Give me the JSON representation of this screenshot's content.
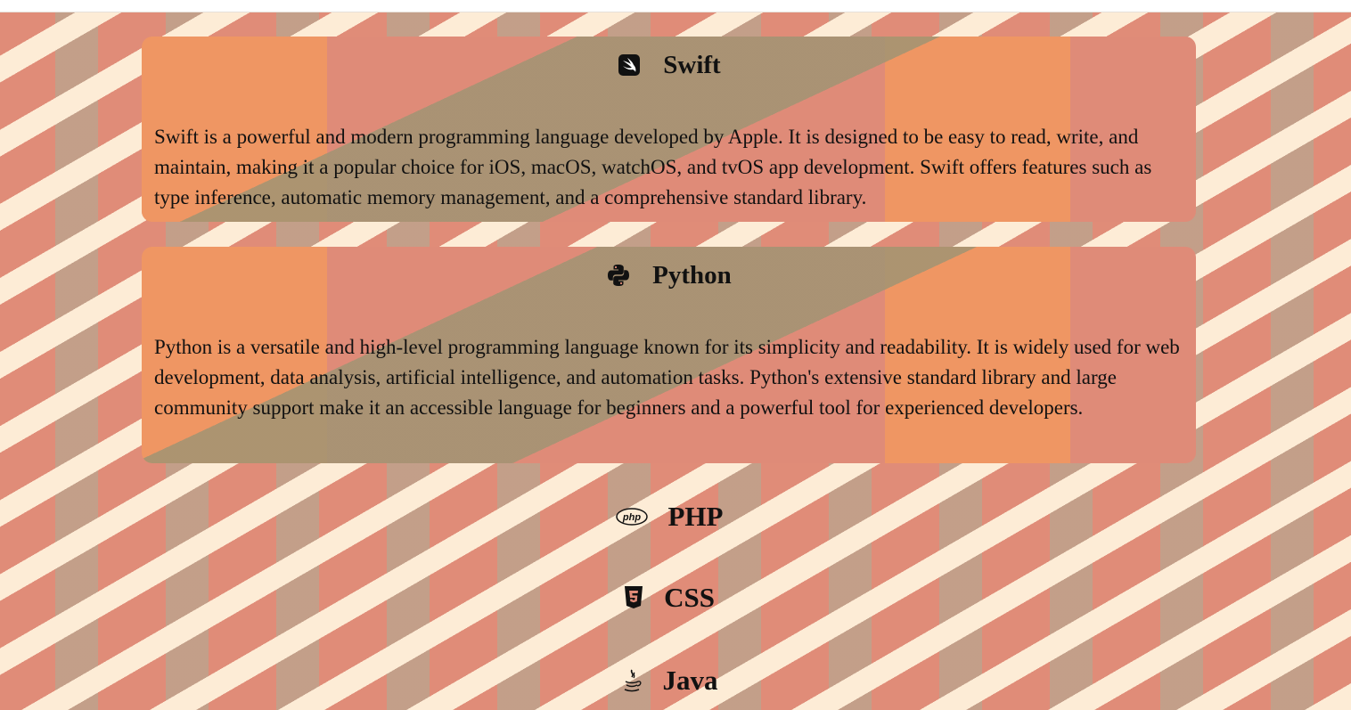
{
  "cards": [
    {
      "title": "Swift",
      "icon": "swift-icon",
      "description": "Swift is a powerful and modern programming language developed by Apple. It is designed to be easy to read, write, and maintain, making it a popular choice for iOS, macOS, watchOS, and tvOS app development. Swift offers features such as type inference, automatic memory management, and a comprehensive standard library."
    },
    {
      "title": "Python",
      "icon": "python-icon",
      "description": "Python is a versatile and high-level programming language known for its simplicity and readability. It is widely used for web development, data analysis, artificial intelligence, and automation tasks. Python's extensive standard library and large community support make it an accessible language for beginners and a powerful tool for experienced developers."
    }
  ],
  "collapsed": [
    {
      "title": "PHP",
      "icon": "php-icon"
    },
    {
      "title": "CSS",
      "icon": "css3-icon"
    },
    {
      "title": "Java",
      "icon": "java-icon"
    }
  ],
  "colors": {
    "cream": "#fdecd6",
    "salmon": "#e08c78",
    "orange": "#ef9663",
    "olive": "#a8957a"
  }
}
